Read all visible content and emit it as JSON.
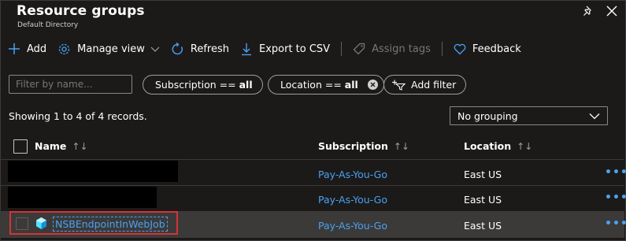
{
  "blade": {
    "title": "Resource groups",
    "subtitle": "Default Directory"
  },
  "toolbar": {
    "add": "Add",
    "manage_view": "Manage view",
    "refresh": "Refresh",
    "export": "Export to CSV",
    "assign_tags": "Assign tags",
    "feedback": "Feedback"
  },
  "filters": {
    "name_placeholder": "Filter by name...",
    "subscription_label": "Subscription ==",
    "subscription_value": "all",
    "location_label": "Location ==",
    "location_value": "all",
    "add_filter": "Add filter"
  },
  "summary": {
    "showing": "Showing 1 to 4 of 4 records.",
    "grouping": "No grouping"
  },
  "table": {
    "columns": {
      "name": "Name",
      "subscription": "Subscription",
      "location": "Location",
      "sort": "↑↓"
    },
    "rows": [
      {
        "name": "",
        "subscription": "Pay-As-You-Go",
        "location": "East US",
        "more": "•••"
      },
      {
        "name": "",
        "subscription": "Pay-As-You-Go",
        "location": "East US",
        "more": "•••"
      },
      {
        "name": "NSBEndpointInWebJob",
        "subscription": "Pay-As-You-Go",
        "location": "East US",
        "more": "•••"
      }
    ]
  },
  "colors": {
    "accent": "#4aa1f3",
    "highlight": "#d13438",
    "background": "#1b1a19"
  }
}
